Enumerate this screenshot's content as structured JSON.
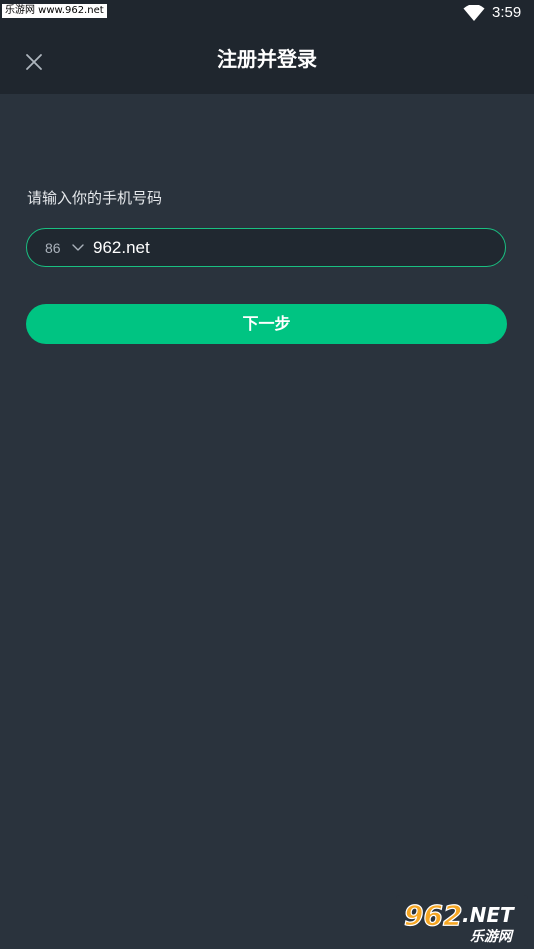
{
  "status_bar": {
    "watermark_text": "乐游网 www.962.net",
    "time": "3:59",
    "wifi_icon": "wifi-icon"
  },
  "header": {
    "title": "注册并登录",
    "close_icon": "close-icon"
  },
  "form": {
    "prompt": "请输入你的手机号码",
    "country_code": "86",
    "phone_value": "962.net",
    "next_label": "下一步"
  },
  "colors": {
    "background": "#2a333d",
    "header_background": "#1f262e",
    "accent": "#00c482",
    "field_border": "#19c081"
  },
  "watermark_logo": {
    "text": "962.NET 乐游网"
  }
}
